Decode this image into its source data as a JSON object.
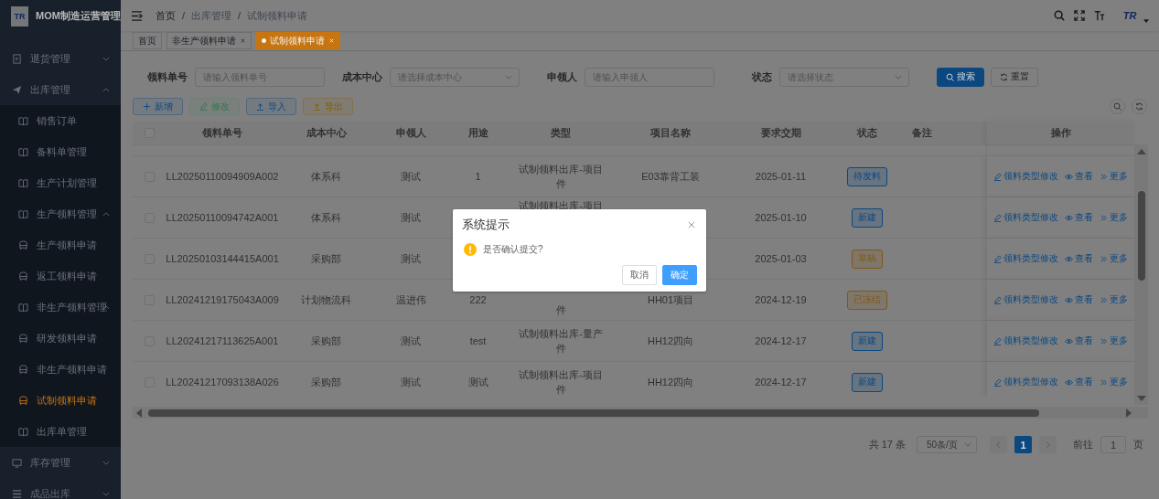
{
  "app": {
    "logo_text": "TR",
    "title": "MOM制造运营管理"
  },
  "sidebar": {
    "items": [
      {
        "label": "退货管理",
        "kind": "doc",
        "expanded": false
      },
      {
        "label": "出库管理",
        "kind": "plane",
        "expanded": true,
        "children": [
          {
            "label": "销售订单",
            "kind": "book",
            "selected": false
          },
          {
            "label": "备料单管理",
            "kind": "book",
            "selected": false
          },
          {
            "label": "生产计划管理",
            "kind": "book",
            "selected": false
          },
          {
            "label": "生产领料管理",
            "kind": "book",
            "expanded": true,
            "children": [
              {
                "label": "生产领料申请",
                "kind": "bus",
                "selected": false
              },
              {
                "label": "返工领料申请",
                "kind": "bus",
                "selected": false
              }
            ]
          },
          {
            "label": "非生产领料管理",
            "kind": "book",
            "expanded": true,
            "children": [
              {
                "label": "研发领料申请",
                "kind": "bus",
                "selected": false
              },
              {
                "label": "非生产领料申请",
                "kind": "bus",
                "selected": false
              },
              {
                "label": "试制领料申请",
                "kind": "bus",
                "selected": true
              }
            ]
          },
          {
            "label": "出库单管理",
            "kind": "book",
            "selected": false
          }
        ]
      },
      {
        "label": "库存管理",
        "kind": "monitor",
        "expanded": false
      },
      {
        "label": "成品出库",
        "kind": "list",
        "expanded": false
      }
    ]
  },
  "breadcrumb": {
    "separator": "/",
    "items": [
      "首页",
      "出库管理",
      "试制领料申请"
    ]
  },
  "header": {
    "avatar_text": "TR"
  },
  "tags": [
    {
      "label": "首页",
      "closable": false,
      "selected": false
    },
    {
      "label": "非生产领料申请",
      "closable": true,
      "selected": false
    },
    {
      "label": "试制领料申请",
      "closable": true,
      "selected": true
    }
  ],
  "filters": [
    {
      "label": "领料单号",
      "placeholder": "请输入领料单号",
      "kind": "input"
    },
    {
      "label": "成本中心",
      "placeholder": "请选择成本中心",
      "kind": "select"
    },
    {
      "label": "申领人",
      "placeholder": "请输入申领人",
      "kind": "input"
    },
    {
      "label": "状态",
      "placeholder": "请选择状态",
      "kind": "select"
    }
  ],
  "filter_buttons": [
    {
      "label": "搜索",
      "kind": "search"
    },
    {
      "label": "重置",
      "kind": "reset"
    }
  ],
  "toolbar": [
    {
      "label": "新增",
      "kind": "add",
      "disabled": false
    },
    {
      "label": "修改",
      "kind": "edit",
      "disabled": true
    },
    {
      "label": "导入",
      "kind": "import",
      "disabled": false
    },
    {
      "label": "导出",
      "kind": "export",
      "disabled": false
    }
  ],
  "table": {
    "header_checked": false,
    "columns": [
      "领料单号",
      "成本中心",
      "申领人",
      "用途",
      "类型",
      "项目名称",
      "要求交期",
      "状态",
      "备注",
      "操作"
    ],
    "rows": [
      {
        "checked": false,
        "order": "LL20250110094909A002",
        "cost_center": "体系科",
        "applicant": "测试",
        "purpose": "1",
        "type": {
          "text": "试制领料出库-项目件",
          "start_covered": false,
          "end_covered": false
        },
        "project": "E03靠背工装",
        "due": "2025-01-11",
        "status": {
          "label": "待发料",
          "color": "#0c4880"
        },
        "actions": [
          "领料类型修改",
          "查看",
          "更多"
        ]
      },
      {
        "checked": false,
        "order": "LL20250110094742A001",
        "cost_center": "体系科",
        "applicant": "测试",
        "type": {
          "text": "试制领料出库-项目",
          "start_covered": false,
          "end_covered": true
        },
        "due": "2025-01-10",
        "status": {
          "label": "新建",
          "color": "#0c4880"
        },
        "actions": [
          "领料类型修改",
          "查看",
          "更多"
        ]
      },
      {
        "checked": false,
        "order": "LL20250103144415A001",
        "cost_center": "采购部",
        "applicant": "测试",
        "due": "2025-01-03",
        "status": {
          "label": "草稿",
          "color": "#80561a"
        },
        "actions": [
          "领料类型修改",
          "查看",
          "更多"
        ]
      },
      {
        "checked": false,
        "order": "LL20241219175043A009",
        "cost_center": "计划物流科",
        "applicant": "温进伟",
        "purpose": "222",
        "type": {
          "text": "件",
          "start_covered": true,
          "end_covered": false
        },
        "project": "HH01项目",
        "due": "2024-12-19",
        "status": {
          "label": "已冻结",
          "color": "#80561a"
        },
        "actions": [
          "领料类型修改",
          "查看",
          "更多"
        ]
      },
      {
        "checked": false,
        "order": "LL20241217113625A001",
        "cost_center": "采购部",
        "applicant": "测试",
        "purpose": "test",
        "type": {
          "text": "试制领料出库-量产件",
          "start_covered": false,
          "end_covered": false
        },
        "project": "HH12四向",
        "due": "2024-12-17",
        "status": {
          "label": "新建",
          "color": "#0c4880"
        },
        "actions": [
          "领料类型修改",
          "查看",
          "更多"
        ]
      },
      {
        "checked": false,
        "order": "LL20241217093138A026",
        "cost_center": "采购部",
        "applicant": "测试",
        "purpose": "测试",
        "type": {
          "text": "试制领料出库-项目件",
          "start_covered": false,
          "end_covered": false
        },
        "project": "HH12四向",
        "due": "2024-12-17",
        "status": {
          "label": "新建",
          "color": "#0c4880"
        },
        "actions": [
          "领料类型修改",
          "查看",
          "更多"
        ]
      }
    ]
  },
  "pagination": {
    "total": "共 17 条",
    "page_size": "50条/页",
    "pages": [
      {
        "label": "1",
        "selected": true
      }
    ],
    "goto_label": "前往",
    "goto_value": "1",
    "goto_suffix": "页"
  },
  "dialog": {
    "title": "系统提示",
    "message": "是否确认提交?",
    "buttons": [
      {
        "label": "取消",
        "kind": "cancel"
      },
      {
        "label": "确定",
        "kind": "confirm"
      }
    ]
  }
}
